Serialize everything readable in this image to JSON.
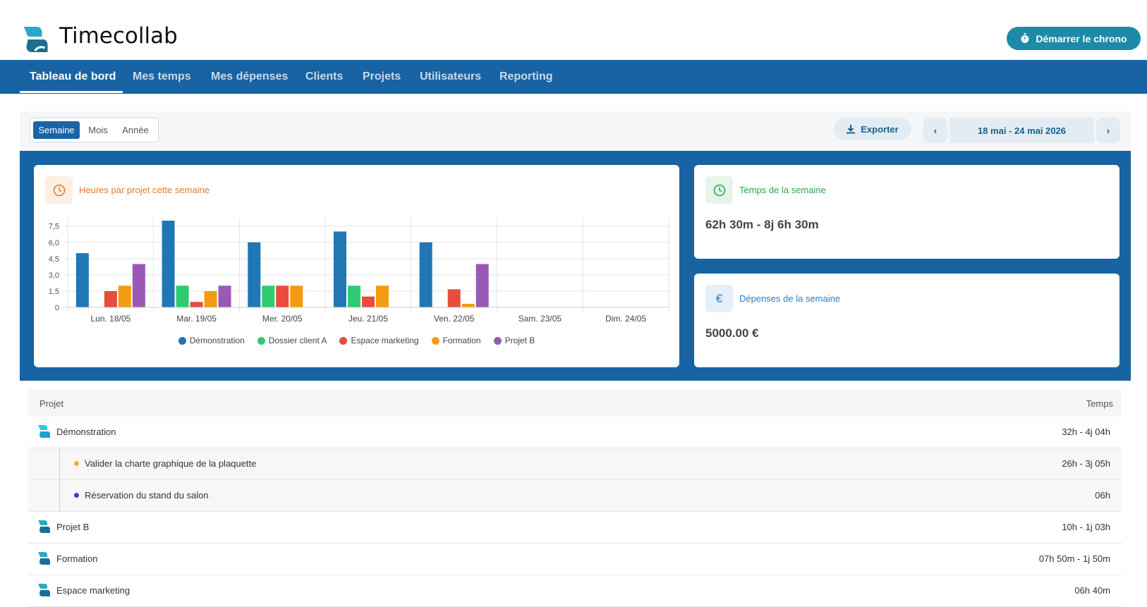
{
  "app": {
    "title": "Timecollab",
    "chrono_label": "Démarrer le chrono"
  },
  "nav": [
    {
      "label": "Tableau de bord",
      "active": true
    },
    {
      "label": "Mes temps"
    },
    {
      "label": "Mes dépenses"
    },
    {
      "label": "Clients"
    },
    {
      "label": "Projets"
    },
    {
      "label": "Utilisateurs"
    },
    {
      "label": "Reporting"
    }
  ],
  "period": {
    "options": [
      "Semaine",
      "Mois",
      "Année"
    ],
    "selected": "Semaine"
  },
  "toolbar": {
    "export_label": "Exporter",
    "date_range": "18 mai - 24 mai 2026"
  },
  "cards": {
    "chart_title": "Heures par projet cette semaine",
    "time_title": "Temps de la semaine",
    "time_value": "62h 30m - 8j 6h 30m",
    "expense_title": "Dépenses de la semaine",
    "expense_value": "5000.00 €",
    "euro_symbol": "€"
  },
  "colors": {
    "accent": "#1863a3",
    "chrono": "#1d8aa8",
    "chart_orange": "#e07b2c",
    "time_green": "#2ba84a",
    "expense_blue": "#2b7fc4"
  },
  "chart_data": {
    "type": "bar",
    "categories": [
      "Lun. 18/05",
      "Mar. 19/05",
      "Mer. 20/05",
      "Jeu. 21/05",
      "Ven. 22/05",
      "Sam. 23/05",
      "Dim. 24/05"
    ],
    "series": [
      {
        "name": "Démonstration",
        "color": "#1f77b4",
        "values": [
          5,
          8,
          6,
          7,
          6,
          0,
          0
        ]
      },
      {
        "name": "Dossier client A",
        "color": "#2ecc71",
        "values": [
          0,
          2,
          2,
          2,
          0,
          0,
          0
        ]
      },
      {
        "name": "Espace marketing",
        "color": "#e74c3c",
        "values": [
          1.5,
          0.5,
          2,
          1,
          1.67,
          0,
          0
        ]
      },
      {
        "name": "Formation",
        "color": "#f39c12",
        "values": [
          2,
          1.5,
          2,
          2,
          0.33,
          0,
          0
        ]
      },
      {
        "name": "Projet B",
        "color": "#9b59b6",
        "values": [
          4,
          2,
          0,
          0,
          4,
          0,
          0
        ]
      }
    ],
    "yticks": [
      "0",
      "1,5",
      "3,0",
      "4,5",
      "6,0",
      "7,5"
    ],
    "ylim": [
      0,
      8
    ],
    "legend_position": "bottom",
    "grid": true
  },
  "table": {
    "col_project": "Projet",
    "col_time": "Temps",
    "rows": [
      {
        "name": "Démonstration",
        "time": "32h - 4j 04h",
        "kind": "project"
      },
      {
        "name": "Valider la charte graphique de la plaquette",
        "time": "26h - 3j 05h",
        "kind": "task",
        "dot": "#e8b52a"
      },
      {
        "name": "Réservation du stand du salon",
        "time": "06h",
        "kind": "task",
        "dot": "#3b3bd6"
      },
      {
        "name": "Projet B",
        "time": "10h - 1j 03h",
        "kind": "project"
      },
      {
        "name": "Formation",
        "time": "07h 50m - 1j 50m",
        "kind": "project"
      },
      {
        "name": "Espace marketing",
        "time": "06h 40m",
        "kind": "project"
      }
    ]
  }
}
